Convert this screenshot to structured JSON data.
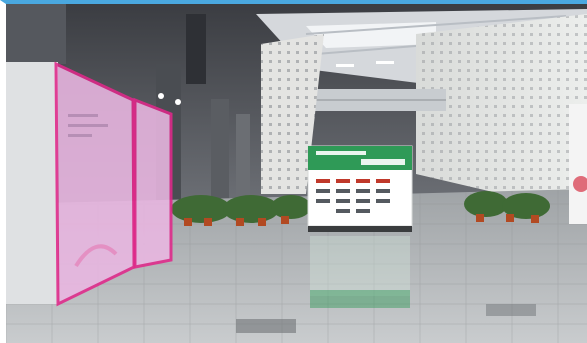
{
  "scene": {
    "type": "photo",
    "subject": "exhibition-hall-lobby",
    "highlight_color": "#e0288a",
    "highlight_fill": "#eab7e2",
    "frame_color": "#4aa8e0"
  },
  "sign": {
    "title": "",
    "date": "",
    "colors": {
      "header": "#2f9a57",
      "body": "#ffffff"
    }
  }
}
